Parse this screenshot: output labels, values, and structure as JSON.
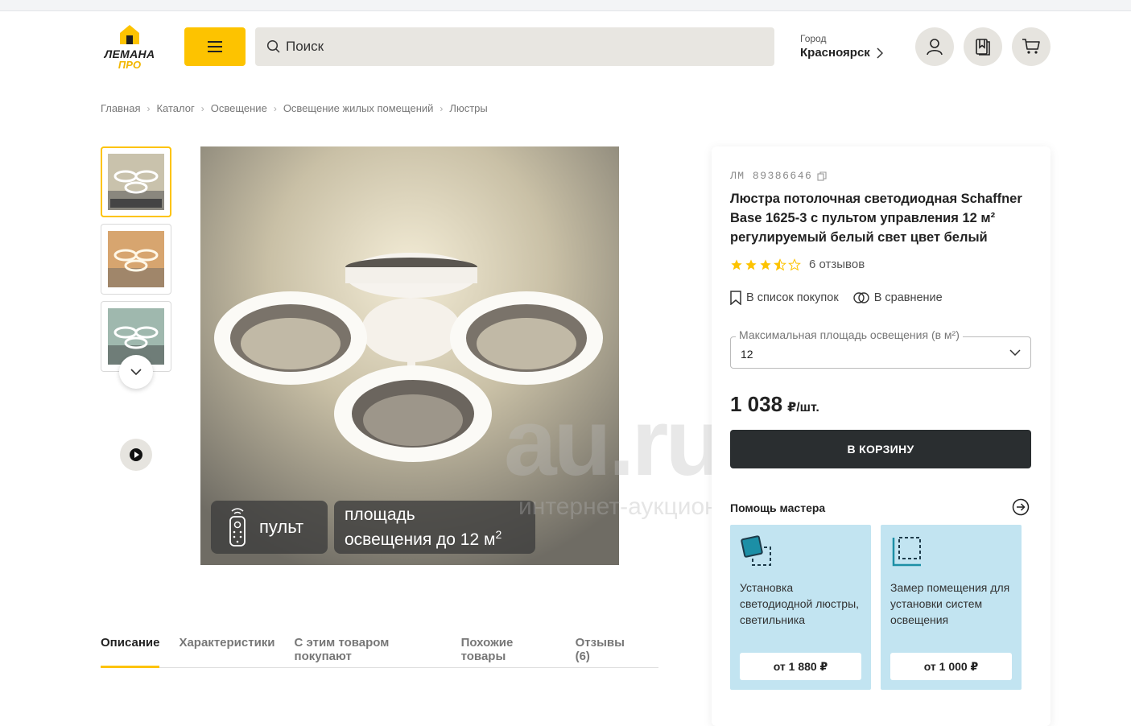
{
  "header": {
    "logo_line1": "ЛЕМАНА",
    "logo_line2": "ПРО",
    "search_placeholder": "Поиск",
    "city_label": "Город",
    "city_value": "Красноярск",
    "brand_yellow": "#fdc300"
  },
  "breadcrumbs": [
    "Главная",
    "Каталог",
    "Освещение",
    "Освещение жилых помещений",
    "Люстры"
  ],
  "gallery": {
    "badge_remote": "пульт",
    "badge_area_line1": "площадь",
    "badge_area_line2": "освещения до 12 м",
    "badge_area_sup": "2"
  },
  "watermark": {
    "big": "au.ru",
    "small": "интернет-аукцион"
  },
  "tabs": [
    "Описание",
    "Характеристики",
    "С этим товаром покупают",
    "Похожие товары",
    "Отзывы (6)"
  ],
  "product": {
    "sku": "ЛМ 89386646",
    "title": "Люстра потолочная светодиодная Schaffner Base 1625-3 с пультом управления 12 м² регулируемый белый свет цвет белый",
    "rating": 3.5,
    "reviews": "6 отзывов",
    "add_to_list": "В список покупок",
    "compare": "В сравнение",
    "select_label": "Максимальная площадь освещения (в м²)",
    "select_value": "12",
    "price": "1 038",
    "price_unit": "₽/шт.",
    "cart_button": "В КОРЗИНУ"
  },
  "help": {
    "title": "Помощь мастера",
    "services": [
      {
        "text": "Установка светодиодной люстры, светильника",
        "price": "от 1 880 ₽"
      },
      {
        "text": "Замер помещения для установки систем освещения",
        "price": "от 1 000 ₽"
      }
    ]
  }
}
